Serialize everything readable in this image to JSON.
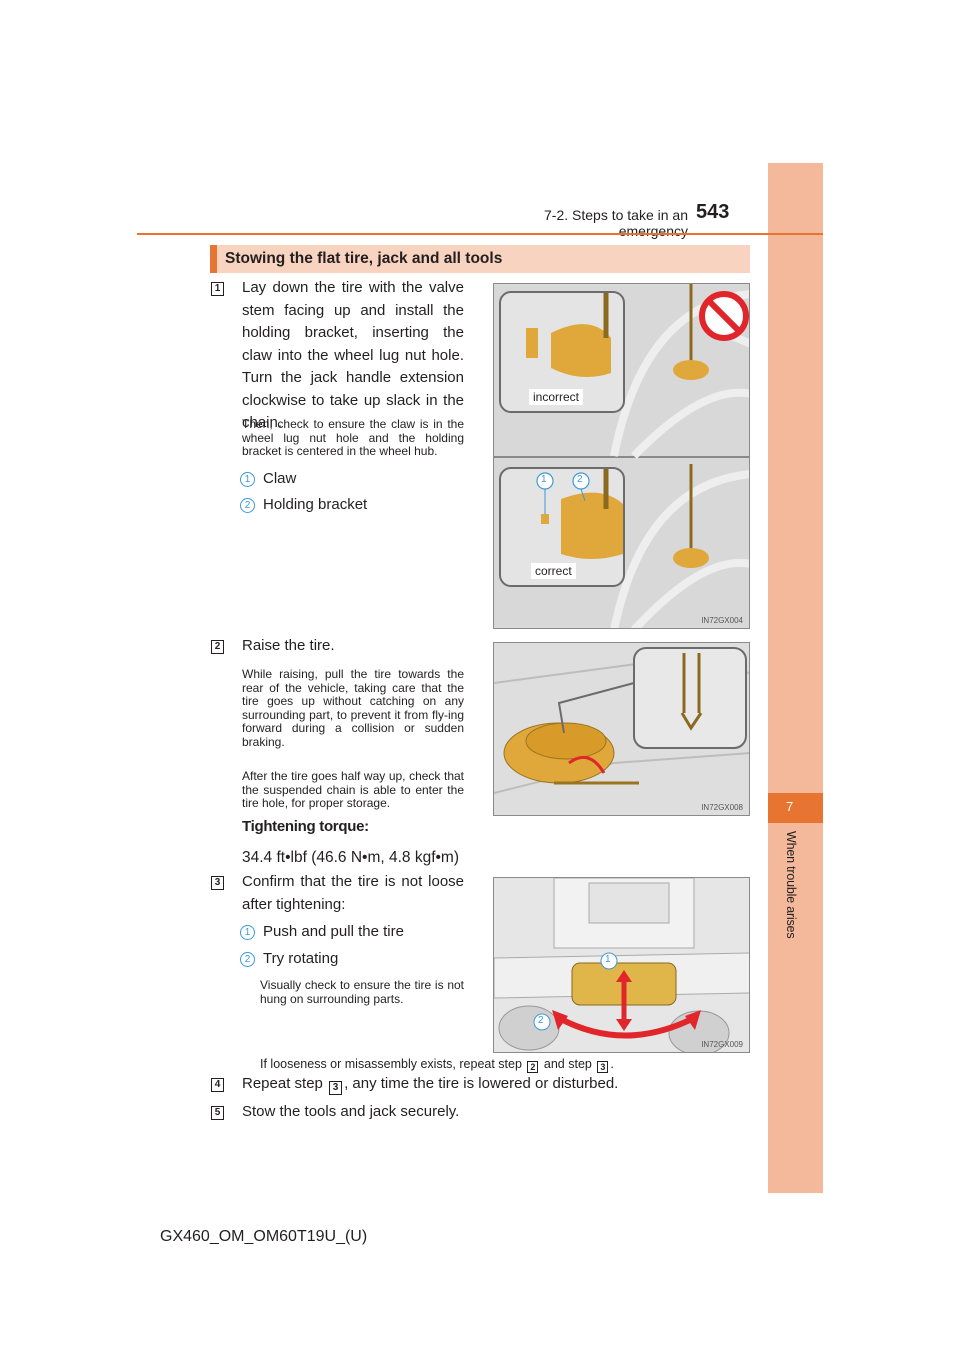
{
  "header": {
    "running_head": "7-2. Steps to take in an emergency",
    "page_number": "543",
    "accent_color": "#e87431",
    "tab_color": "#f3b99a"
  },
  "side_tab": {
    "chapter_number": "7",
    "chapter_title": "When trouble arises"
  },
  "section": {
    "title": "Stowing the flat tire, jack and all tools"
  },
  "steps": [
    {
      "number": "1",
      "text": "Lay down the tire with the valve stem facing up and install the holding bracket, inserting the claw into the wheel lug nut hole. Turn the jack handle extension clockwise to take up slack in the chain.",
      "note": "Then, check to ensure the claw is in the wheel lug nut hole and the holding bracket is centered in the wheel hub.",
      "callouts": [
        {
          "number": "1",
          "label": "Claw"
        },
        {
          "number": "2",
          "label": "Holding bracket"
        }
      ],
      "figure": {
        "code": "IN72GX004",
        "inset_labels": [
          "incorrect",
          "correct"
        ],
        "callout_numbers": [
          "1",
          "2"
        ],
        "prohibition_icon": "no-symbol-icon"
      }
    },
    {
      "number": "2",
      "text": "Raise the tire.",
      "notes": [
        "While raising, pull the tire towards the rear of the vehicle, taking care that the tire goes up without catching on any surrounding part, to prevent it from fly-ing forward during a collision or sudden braking.",
        "After the tire goes half way up, check that the suspended chain is able to enter the tire hole, for proper storage."
      ],
      "torque_label": "Tightening torque:",
      "torque_value": "34.4 ft•lbf (46.6 N•m, 4.8 kgf•m)",
      "figure": {
        "code": "IN72GX008"
      }
    },
    {
      "number": "3",
      "text": "Confirm that the tire is not loose after tightening:",
      "callouts": [
        {
          "number": "1",
          "label": "Push and pull the tire"
        },
        {
          "number": "2",
          "label": "Try rotating"
        }
      ],
      "note": "Visually check to ensure the tire is not hung on surrounding parts.",
      "figure": {
        "code": "IN72GX009",
        "callout_numbers": [
          "1",
          "2"
        ]
      },
      "repeat_note": {
        "before": "If looseness or misassembly exists, repeat step",
        "step_a": "2",
        "middle": "and step",
        "step_b": "3",
        "after": "."
      }
    },
    {
      "number": "4",
      "before": "Repeat step",
      "ref_step": "3",
      "after": ", any time the tire is lowered or disturbed."
    },
    {
      "number": "5",
      "text": "Stow the tools and jack securely."
    }
  ],
  "footer": {
    "document_code": "GX460_OM_OM60T19U_(U)"
  }
}
